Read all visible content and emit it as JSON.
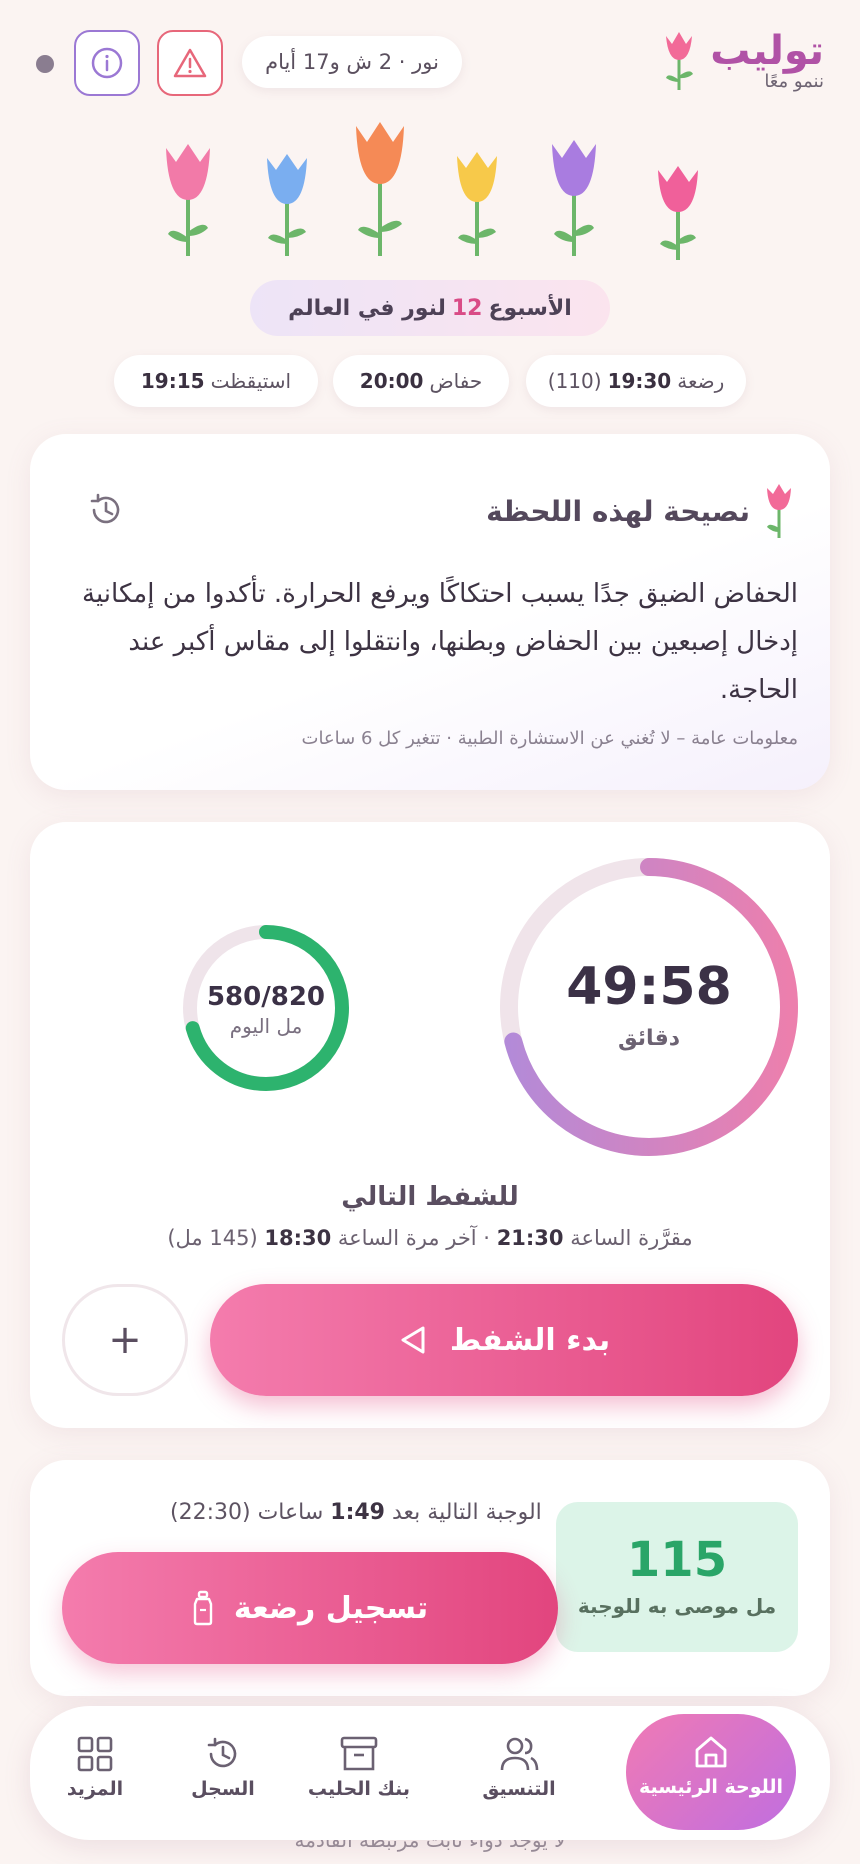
{
  "brand": {
    "title": "توليب",
    "subtitle": "ننمو معًا"
  },
  "baby": {
    "summary": "نور · 2 ش و17 أيام"
  },
  "week": {
    "prefix": "الأسبوع",
    "number": "12",
    "suffix": "لنور في العالم"
  },
  "stats": [
    {
      "label": "رضعة",
      "time": "19:30",
      "extra": "(110)"
    },
    {
      "label": "حفاض",
      "time": "20:00",
      "extra": ""
    },
    {
      "label": "استيقظت",
      "time": "19:15",
      "extra": ""
    }
  ],
  "tip": {
    "title": "نصيحة لهذه اللحظة",
    "body": "الحفاض الضيق جدًا يسبب احتكاكًا ويرفع الحرارة. تأكدوا من إمكانية إدخال إصبعين بين الحفاض وبطنها، وانتقلوا إلى مقاس أكبر عند الحاجة.",
    "footer": "معلومات عامة – لا تُغني عن الاستشارة الطبية · تتغير كل 6 ساعات"
  },
  "pump": {
    "timer": "49:58",
    "timer_unit": "دقائق",
    "timer_progress": 0.71,
    "ml_today": "580/820",
    "ml_unit": "مل اليوم",
    "ml_progress": 0.707,
    "next_label": "للشفط التالي",
    "sched_prefix": "مقرَّرة الساعة",
    "sched_time": "21:30",
    "last_prefix": "· آخر مرة الساعة",
    "last_time": "18:30",
    "last_amount": "(145 مل)",
    "start_label": "بدء الشفط",
    "add_label": "+"
  },
  "feeding": {
    "recommended": "115",
    "recommended_label": "مل موصى به للوجبة",
    "next_prefix": "الوجبة التالية بعد",
    "next_in": "1:49",
    "next_suffix": "ساعات (22:30)",
    "log_label": "تسجيل رضعة"
  },
  "nav": [
    {
      "label": "اللوحة الرئيسية",
      "icon": "home-icon",
      "active": true
    },
    {
      "label": "التنسيق",
      "icon": "users-icon",
      "active": false
    },
    {
      "label": "بنك الحليب",
      "icon": "archive-icon",
      "active": false
    },
    {
      "label": "السجل",
      "icon": "history-icon",
      "active": false
    },
    {
      "label": "المزيد",
      "icon": "grid-icon",
      "active": false
    }
  ],
  "peek_text": "لا يوجد دواء ثابت مرتبطة القادمة",
  "colors": {
    "primary_pink": "#e2457e",
    "brand_purple": "#b052a6",
    "success_green": "#2aa568",
    "alert_red": "#e7677a",
    "info_purple": "#9b78d4"
  }
}
